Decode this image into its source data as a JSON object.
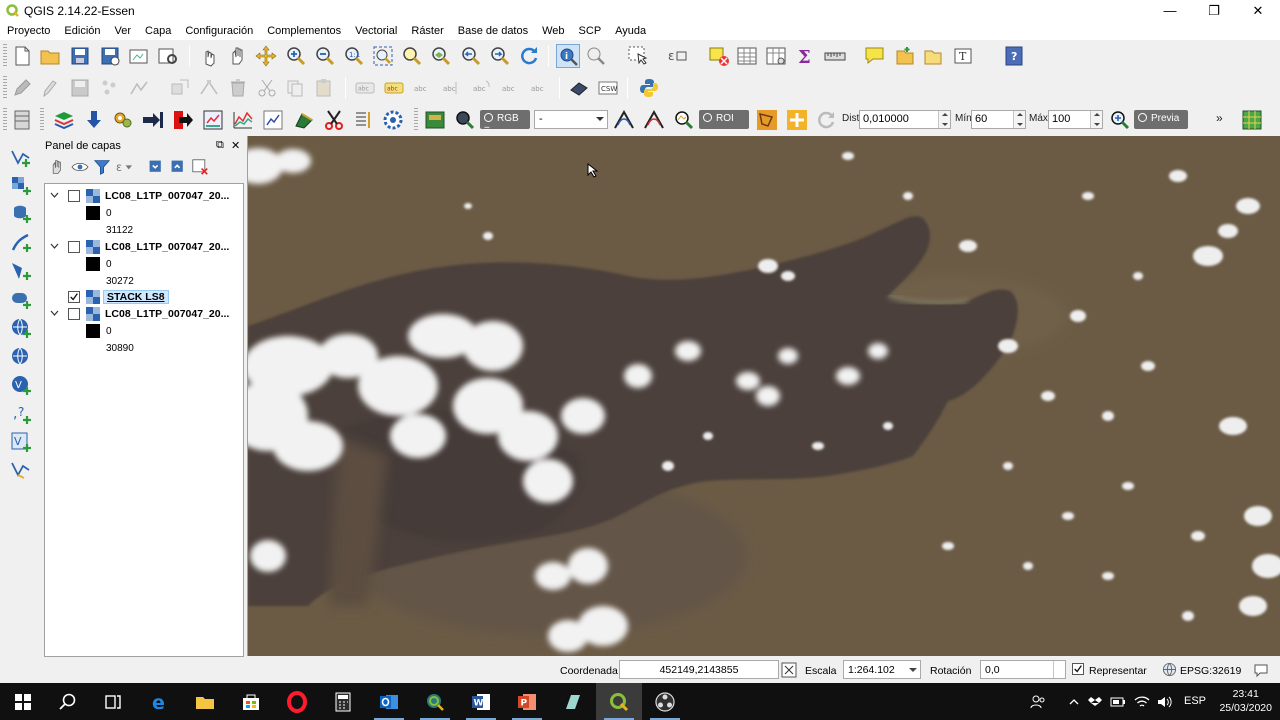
{
  "window": {
    "title": "QGIS 2.14.22-Essen",
    "controls": [
      "minimize",
      "restore",
      "close"
    ]
  },
  "menu": {
    "items": [
      "Proyecto",
      "Edición",
      "Ver",
      "Capa",
      "Configuración",
      "Complementos",
      "Vectorial",
      "Ráster",
      "Base de datos",
      "Web",
      "SCP",
      "Ayuda"
    ]
  },
  "scp_toolbar": {
    "rgb_label": "RGB =",
    "rgb_value": "-",
    "roi_label": "ROI",
    "dist_label": "Dist",
    "dist_value": "0,010000",
    "min_label": "Mín",
    "min_value": "60",
    "max_label": "Máx",
    "max_value": "100",
    "preview_label": "Previa",
    "more": "»"
  },
  "layers_panel": {
    "title": "Panel de capas",
    "float_icon": "⧉",
    "close_icon": "✕",
    "layers": [
      {
        "name": "LC08_L1TP_007047_20...",
        "checked": false,
        "legend_min": "0",
        "legend_max": "31122"
      },
      {
        "name": "LC08_L1TP_007047_20...",
        "checked": false,
        "legend_min": "0",
        "legend_max": "30272"
      },
      {
        "name": "STACK LS8",
        "checked": true,
        "selected": true
      },
      {
        "name": "LC08_L1TP_007047_20...",
        "checked": false,
        "legend_min": "0",
        "legend_max": "30890"
      }
    ]
  },
  "status": {
    "coord_label": "Coordenada",
    "coord_value": "452149,2143855",
    "scale_label": "Escala",
    "scale_value": "1:264.102",
    "rotation_label": "Rotación",
    "rotation_value": "0,0",
    "render_label": "Representar",
    "render_checked": true,
    "crs_value": "EPSG:32619"
  },
  "taskbar": {
    "apps": [
      "start",
      "search",
      "task-view",
      "edge",
      "file-explorer",
      "store",
      "opera",
      "calculator",
      "outlook",
      "qgis-browser",
      "word",
      "powerpoint",
      "notes",
      "qgis",
      "obs"
    ],
    "language": "ESP",
    "time": "23:41",
    "date": "25/03/2020"
  },
  "colors": {
    "water": "#6b5b45",
    "land": "#4a3f3b",
    "cloud": "#f2f2f2",
    "selection": "#cde8ff",
    "taskbar": "#101010"
  }
}
